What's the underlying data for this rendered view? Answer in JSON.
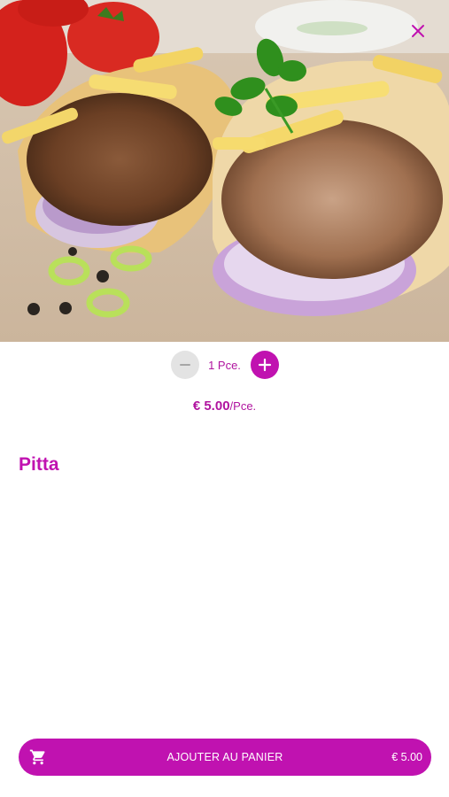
{
  "product": {
    "name": "Pitta",
    "image_alt": "Pitta gyros with fries, onion and parsley"
  },
  "quantity": {
    "value_text": "1 Pce."
  },
  "price": {
    "amount": "€ 5.00",
    "unit": "/Pce."
  },
  "cart_button": {
    "label": "AJOUTER AU PANIER",
    "total": "€ 5.00"
  },
  "icons": {
    "close": "close-icon",
    "minus": "minus-icon",
    "plus": "plus-icon",
    "cart": "shopping-cart-icon"
  },
  "colors": {
    "accent": "#c012b0",
    "accent_text": "#b0149f",
    "minus_bg": "#e3e3e3",
    "background": "#ffffff"
  }
}
